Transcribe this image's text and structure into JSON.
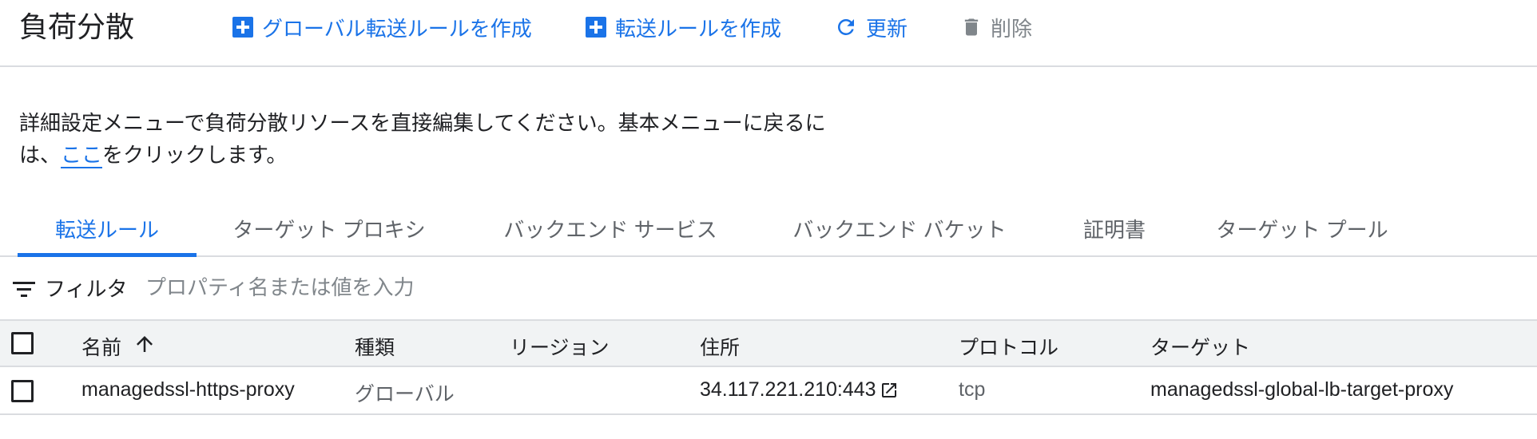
{
  "header": {
    "title": "負荷分散",
    "create_global_rule": "グローバル転送ルールを作成",
    "create_rule": "転送ルールを作成",
    "refresh": "更新",
    "delete": "削除"
  },
  "info": {
    "text_before": "詳細設定メニューで負荷分散リソースを直接編集してください。基本メニューに戻るには、",
    "link": "ここ",
    "text_after": "をクリックします。"
  },
  "tabs": [
    "転送ルール",
    "ターゲット プロキシ",
    "バックエンド サービス",
    "バックエンド バケット",
    "証明書",
    "ターゲット プール"
  ],
  "filter": {
    "label": "フィルタ",
    "placeholder": "プロパティ名または値を入力"
  },
  "table": {
    "headers": [
      "名前",
      "種類",
      "リージョン",
      "住所",
      "プロトコル",
      "ターゲット"
    ],
    "sort_icon": "arrow-upward-icon",
    "rows": [
      {
        "name": "managedssl-https-proxy",
        "type": "グローバル",
        "region": "",
        "address": "34.117.221.210:443",
        "protocol": "tcp",
        "target": "managedssl-global-lb-target-proxy"
      }
    ]
  },
  "colors": {
    "accent": "#1a73e8",
    "text": "#202124",
    "muted": "#5f6368",
    "divider": "#dadce0",
    "header_bg": "#f1f3f4"
  }
}
